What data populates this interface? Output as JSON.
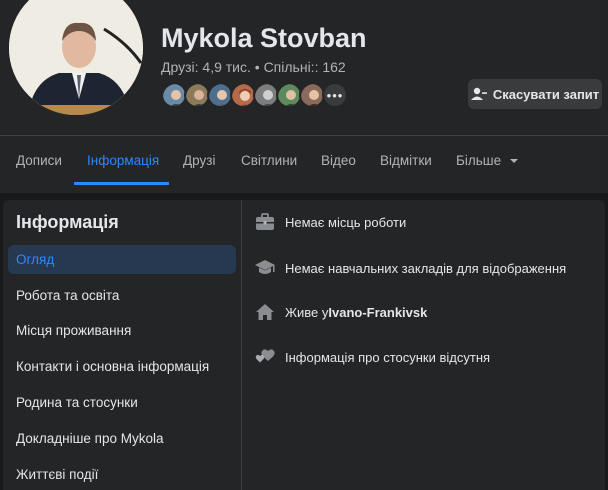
{
  "profile": {
    "name": "Mykola Stovban",
    "friends_line": "Друзі: 4,9 тис. • Спільні:: 162",
    "friend_faces": [
      "#6b8aa8",
      "#8c7a5a",
      "#4e6e8e",
      "#b56a4a",
      "#7d7d7d",
      "#5c8a5c",
      "#8a6a5a"
    ],
    "more_icon": "ellipsis-icon",
    "cancel_request_label": "Скасувати запит"
  },
  "tabs": [
    {
      "label": "Дописи"
    },
    {
      "label": "Інформація"
    },
    {
      "label": "Друзі"
    },
    {
      "label": "Світлини"
    },
    {
      "label": "Відео"
    },
    {
      "label": "Відмітки"
    },
    {
      "label": "Більше"
    }
  ],
  "sidebar": {
    "title": "Інформація",
    "items": [
      {
        "label": "Огляд"
      },
      {
        "label": "Робота та освіта"
      },
      {
        "label": "Місця проживання"
      },
      {
        "label": "Контакти і основна інформація"
      },
      {
        "label": "Родина та стосунки"
      },
      {
        "label": "Докладніше про Mykola"
      },
      {
        "label": "Життєві події"
      }
    ]
  },
  "overview": {
    "work": "Немає місць роботи",
    "education": "Немає навчальних закладів для відображення",
    "lives_prefix": "Живе у ",
    "lives_city": "Ivano-Frankivsk",
    "relationship": "Інформація про стосунки відсутня"
  },
  "colors": {
    "accent": "#2d88ff",
    "background": "#18191a",
    "surface": "#242526"
  }
}
